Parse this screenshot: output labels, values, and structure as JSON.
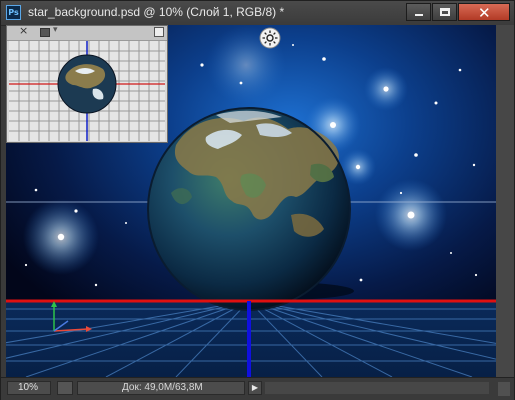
{
  "window": {
    "app_icon": "Ps",
    "title": "star_background.psd @ 10% (Слой 1, RGB/8) *",
    "buttons": [
      "minimize-icon",
      "maximize-icon",
      "close-icon"
    ],
    "close_glyph": "✕"
  },
  "navigator": {
    "close_glyph": "×",
    "menu_arrow": "▾",
    "icons": [
      "close-icon",
      "menu-icon",
      "expand-icon"
    ]
  },
  "status": {
    "zoom": "10%",
    "doc_info": "Док: 49,0M/63,8M",
    "arrow_glyph": "▶"
  },
  "colors": {
    "horizon_line": "#e01010",
    "vertical_axis": "#1010e0",
    "close_button": "#c8482f",
    "space": "#041232"
  }
}
